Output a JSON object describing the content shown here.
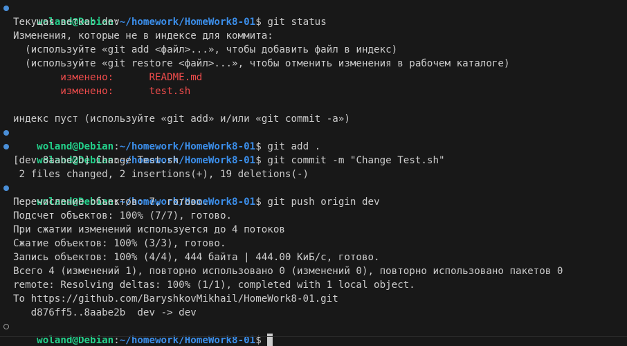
{
  "prompt": {
    "user_host": "woland@Debian",
    "colon": ":",
    "path": "~/homework/HomeWork8-01",
    "dollar": "$ "
  },
  "commands": {
    "status": "git status",
    "add": "git add .",
    "commit": "git commit -m \"Change Test.sh\"",
    "push": "git push origin dev"
  },
  "status_output": {
    "branch": "Текущая ветка: dev",
    "not_staged": "Изменения, которые не в индексе для коммита:",
    "hint_add": "  (используйте «git add <файл>...», чтобы добавить файл в индекс)",
    "hint_restore": "  (используйте «git restore <файл>...», чтобы отменить изменения в рабочем каталоге)",
    "files": [
      {
        "label": "        изменено:      ",
        "name": "README.md"
      },
      {
        "label": "        изменено:      ",
        "name": "test.sh"
      }
    ],
    "index_empty": "индекс пуст (используйте «git add» и/или «git commit -a»)"
  },
  "commit_output": {
    "line1": "[dev 8aabe2b] Change Test.sh",
    "line2": " 2 files changed, 2 insertions(+), 19 deletions(-)"
  },
  "push_output": [
    "Перечисление объектов: 7, готово.",
    "Подсчет объектов: 100% (7/7), готово.",
    "При сжатии изменений используется до 4 потоков",
    "Сжатие объектов: 100% (3/3), готово.",
    "Запись объектов: 100% (4/4), 444 байта | 444.00 КиБ/с, готово.",
    "Всего 4 (изменений 1), повторно использовано 0 (изменений 0), повторно использовано пакетов 0",
    "remote: Resolving deltas: 100% (1/1), completed with 1 local object.",
    "To https://github.com/BaryshkovMikhail/HomeWork8-01.git",
    "   d876ff5..8aabe2b  dev -> dev"
  ],
  "colors": {
    "background": "#181818",
    "foreground": "#cccccc",
    "user_host": "#23d18b",
    "path": "#3b8eea",
    "modified": "#f14c4c",
    "marker": "#4a8fd8"
  }
}
